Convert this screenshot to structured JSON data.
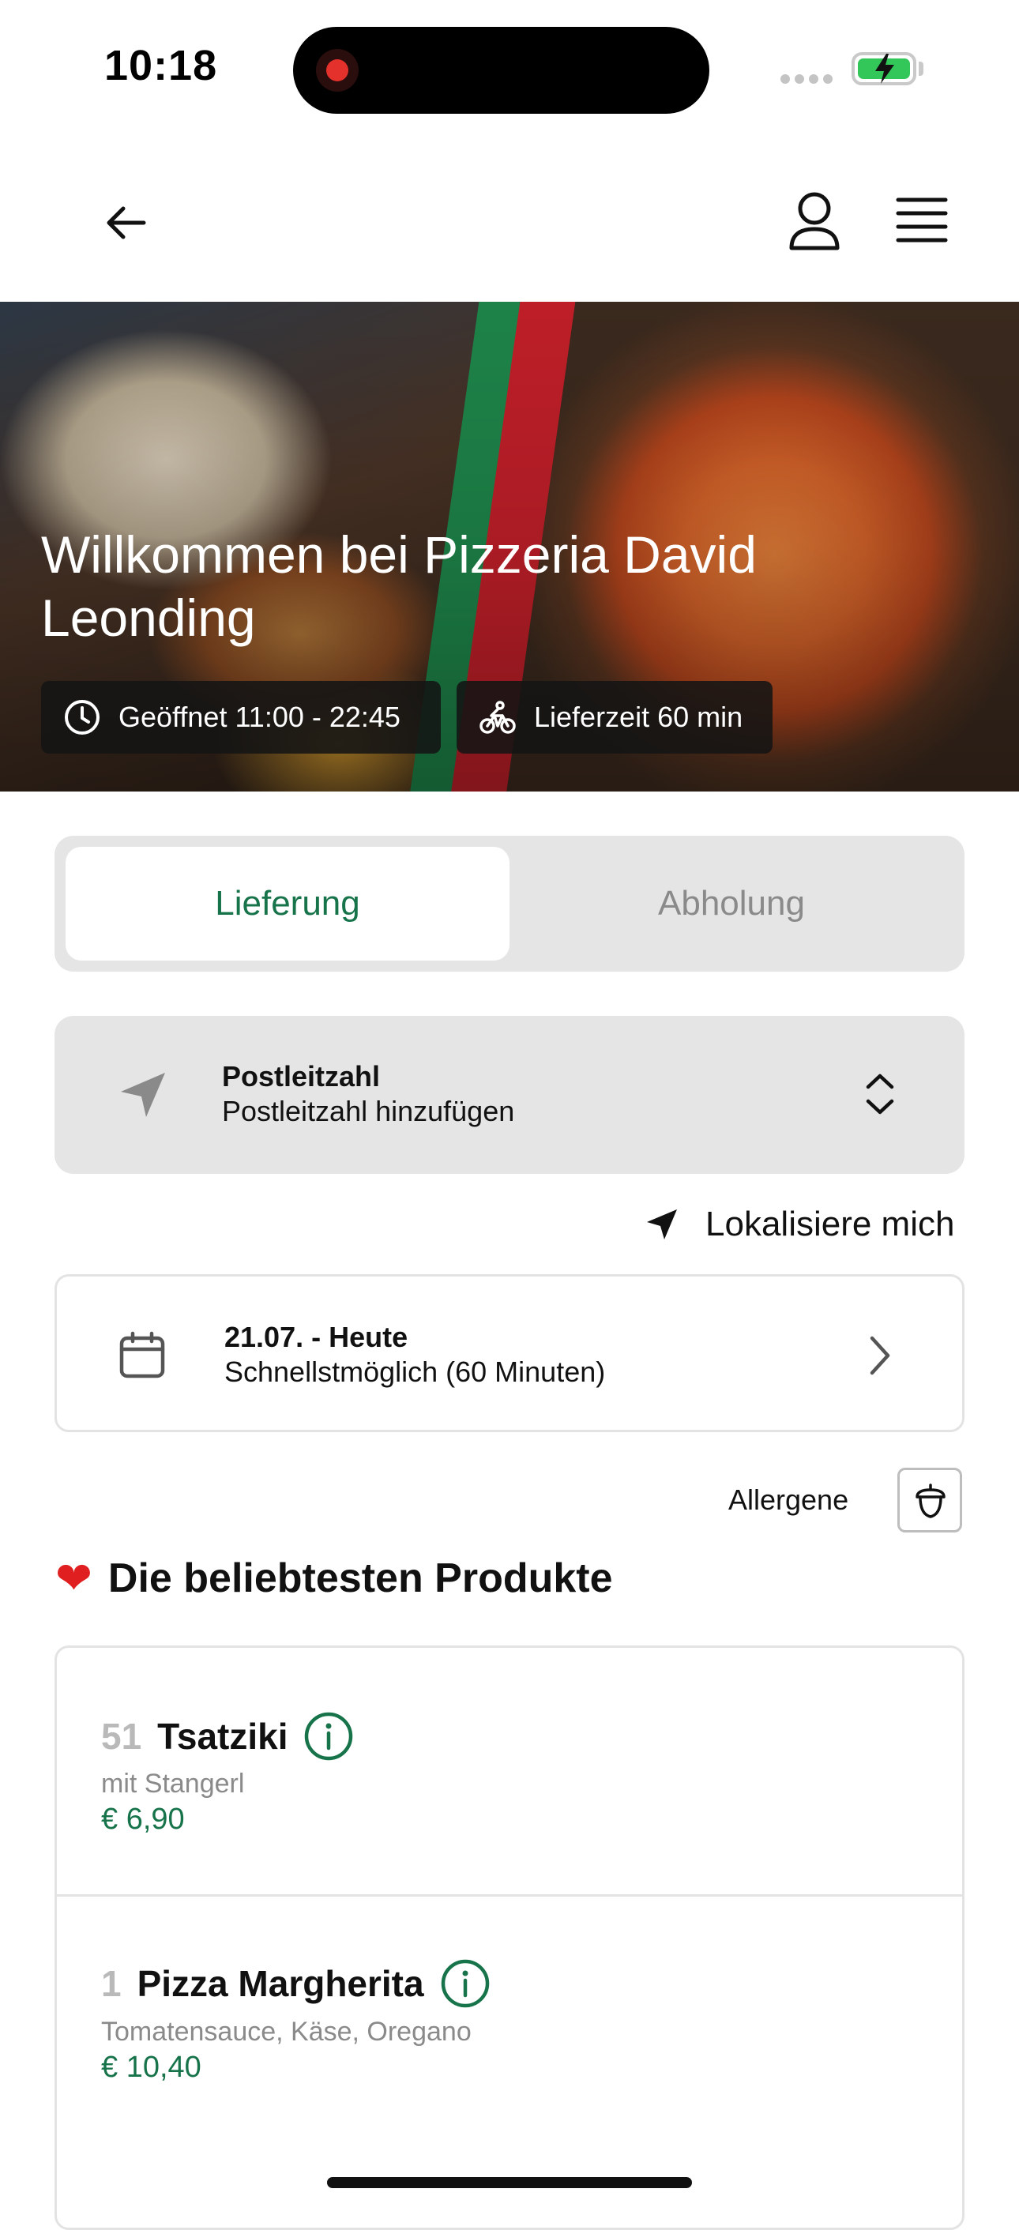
{
  "status_bar": {
    "time": "10:18"
  },
  "hero": {
    "title": "Willkommen bei Pizzeria David Leonding",
    "opening_hours": "Geöffnet 11:00 - 22:45",
    "delivery_time": "Lieferzeit 60 min"
  },
  "tabs": [
    {
      "label": "Lieferung",
      "active": true
    },
    {
      "label": "Abholung",
      "active": false
    }
  ],
  "postal_code": {
    "title": "Postleitzahl",
    "placeholder": "Postleitzahl hinzufügen"
  },
  "localize_label": "Lokalisiere mich",
  "delivery_date": {
    "title": "21.07. - Heute",
    "subtitle": "Schnellstmöglich (60 Minuten)"
  },
  "allergen_label": "Allergene",
  "section_title": "Die beliebtesten Produkte",
  "products": [
    {
      "number": "51",
      "name": "Tsatziki",
      "description": "mit Stangerl",
      "price": "€ 6,90"
    },
    {
      "number": "1",
      "name": "Pizza Margherita",
      "description": "Tomatensauce, Käse, Oregano",
      "price": "€ 10,40"
    }
  ],
  "colors": {
    "accent": "#17734a",
    "segment_bg": "#e5e5e5",
    "stripe_green": "#1f8a4c",
    "stripe_red": "#c8202a"
  },
  "icons": [
    "back-arrow-icon",
    "profile-icon",
    "menu-icon",
    "clock-icon",
    "bicycle-icon",
    "location-arrow-icon",
    "chevron-up-down-icon",
    "navigation-icon",
    "calendar-icon",
    "chevron-right-icon",
    "acorn-icon",
    "heart-icon",
    "info-icon"
  ]
}
